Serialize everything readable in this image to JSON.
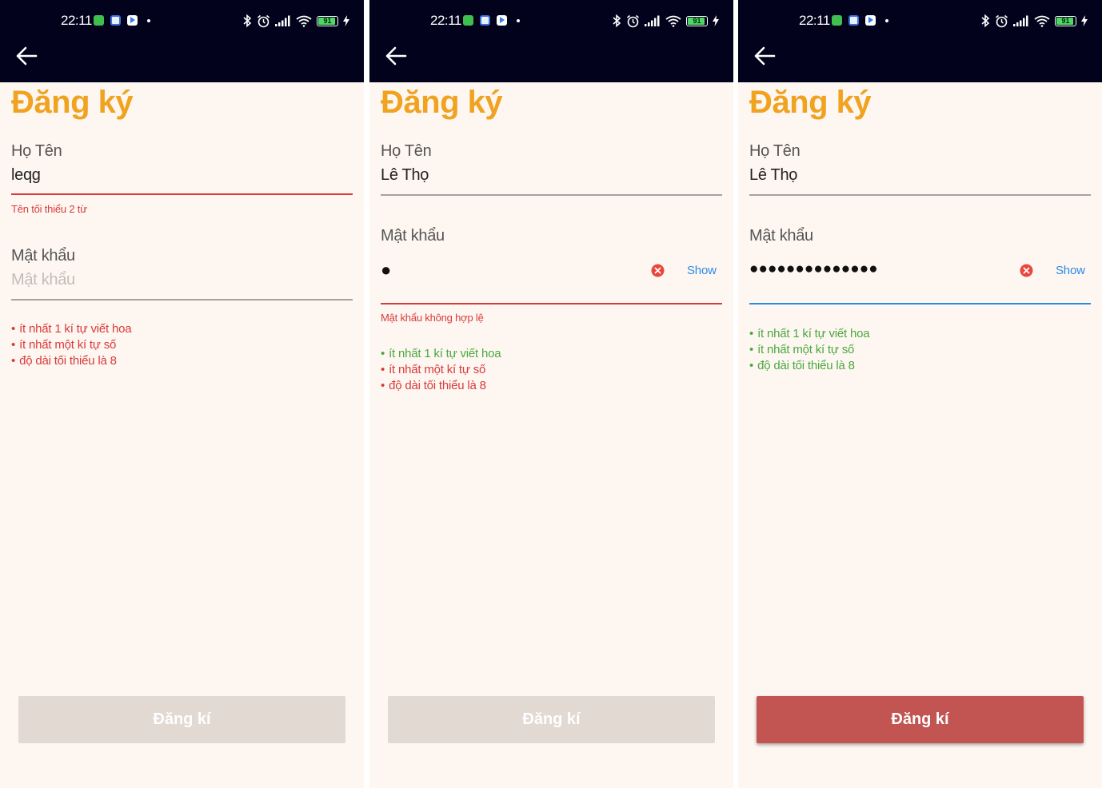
{
  "status": {
    "time": "22:11",
    "battery": "91"
  },
  "screens": [
    {
      "title": "Đăng ký",
      "name_label": "Họ Tên",
      "name_value": "leqg",
      "name_error": "Tên tối thiểu 2 từ",
      "password_label": "Mật khẩu",
      "password_placeholder": "Mật khẩu",
      "rules": [
        "ít nhất 1 kí tự viết hoa",
        "ít nhất một kí tự số",
        "độ dài tối thiểu là 8"
      ],
      "rule_states": [
        "fail",
        "fail",
        "fail"
      ],
      "submit_label": "Đăng kí",
      "submit_enabled": false
    },
    {
      "title": "Đăng ký",
      "name_label": "Họ Tên",
      "name_value": "Lê Thọ",
      "password_label": "Mật khẩu",
      "password_masked": "●",
      "show_label": "Show",
      "password_error": "Mật khẩu không hợp lệ",
      "rules": [
        "ít nhất 1 kí tự viết hoa",
        "ít nhất một kí tự số",
        "độ dài tối thiểu là 8"
      ],
      "rule_states": [
        "pass",
        "fail",
        "fail"
      ],
      "submit_label": "Đăng kí",
      "submit_enabled": false
    },
    {
      "title": "Đăng ký",
      "name_label": "Họ Tên",
      "name_value": "Lê Thọ",
      "password_label": "Mật khẩu",
      "password_masked": "●●●●●●●●●●●●●●",
      "show_label": "Show",
      "rules": [
        "ít nhất 1 kí tự viết hoa",
        "ít nhất một kí tự số",
        "độ dài tối thiểu là 8"
      ],
      "rule_states": [
        "pass",
        "pass",
        "pass"
      ],
      "submit_label": "Đăng kí",
      "submit_enabled": true
    }
  ],
  "colors": {
    "title": "#f0a321",
    "header_bg": "#02021c",
    "error": "#d83a3a",
    "success": "#4aa83f",
    "link": "#2a8be6",
    "submit_enabled": "#c25552",
    "submit_disabled": "#e2d9d3",
    "screen_bg": "#fef7f1"
  }
}
